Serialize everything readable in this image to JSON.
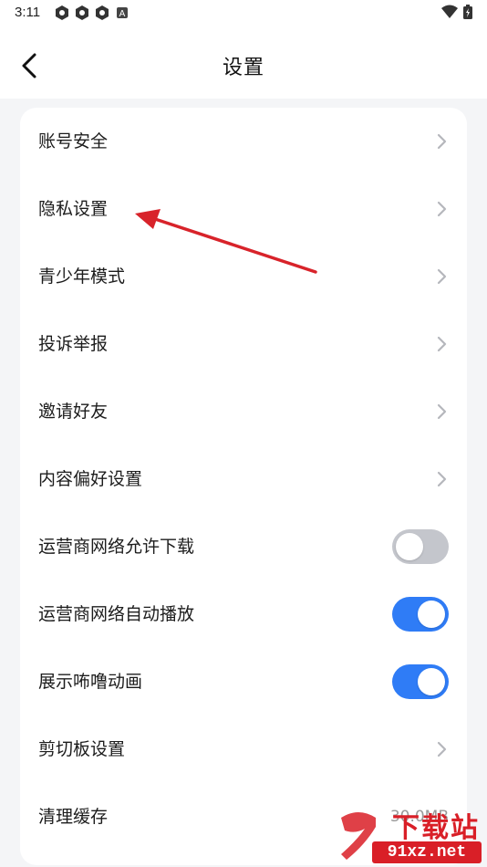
{
  "status_bar": {
    "time": "3:11",
    "left_icons": [
      "app-notification-icon",
      "app-notification-icon",
      "app-notification-icon",
      "a-badge-icon"
    ],
    "right_icons": [
      "wifi-icon",
      "battery-icon"
    ],
    "badge_letter": "A"
  },
  "header": {
    "title": "设置"
  },
  "settings": {
    "items": [
      {
        "label": "账号安全",
        "control": "chevron"
      },
      {
        "label": "隐私设置",
        "control": "chevron"
      },
      {
        "label": "青少年模式",
        "control": "chevron"
      },
      {
        "label": "投诉举报",
        "control": "chevron"
      },
      {
        "label": "邀请好友",
        "control": "chevron"
      },
      {
        "label": "内容偏好设置",
        "control": "chevron"
      },
      {
        "label": "运营商网络允许下载",
        "control": "toggle",
        "state": "off"
      },
      {
        "label": "运营商网络自动播放",
        "control": "toggle",
        "state": "on"
      },
      {
        "label": "展示咘噜动画",
        "control": "toggle",
        "state": "on"
      },
      {
        "label": "剪切板设置",
        "control": "chevron"
      },
      {
        "label": "清理缓存",
        "control": "value",
        "value": "30.0MB"
      }
    ]
  },
  "colors": {
    "accent_toggle_on": "#2f7cf6",
    "toggle_off": "#c4c6cc",
    "annotation_arrow": "#d8232a",
    "watermark_red": "#d91f27"
  },
  "watermark": {
    "text": "下载站",
    "domain": "91xz.net"
  }
}
